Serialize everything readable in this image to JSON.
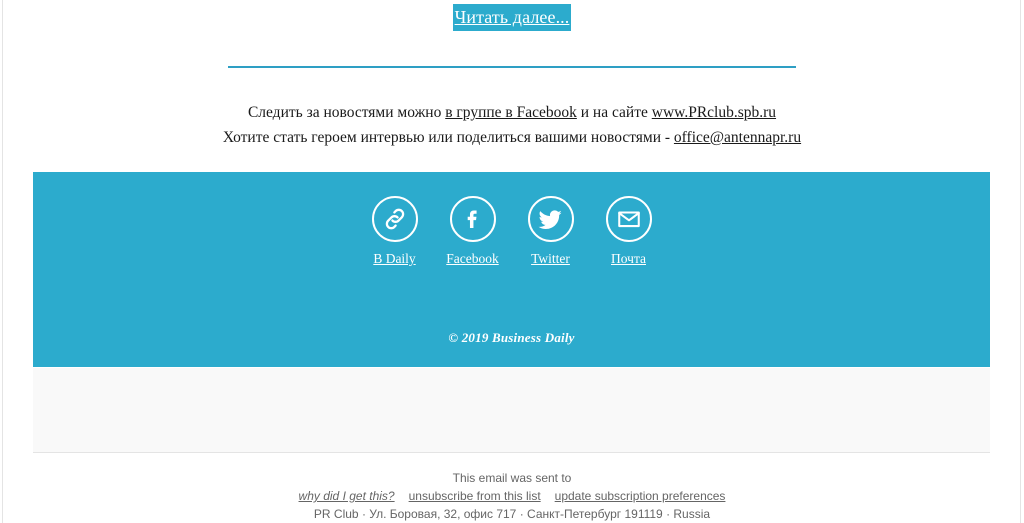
{
  "colors": {
    "brand_teal": "#2CABCD",
    "divider_teal": "#2E9FC4",
    "gray_block": "#F9F9F9",
    "footer_text": "#656565",
    "body_text": "#1A1A1A"
  },
  "read_more": {
    "label": "Читать далее..."
  },
  "intro": {
    "line1": {
      "before": "Следить за новостями можно ",
      "link1": "в группе в Facebook",
      "middle": " и на сайте ",
      "link2": "www.PRclub.spb.ru"
    },
    "line2": {
      "before": "Хотите стать героем интервью или поделиться вашими новостями - ",
      "link1": "office@antennapr.ru"
    }
  },
  "social": {
    "items": [
      {
        "icon": "link-icon",
        "label": "В Daily"
      },
      {
        "icon": "facebook-icon",
        "label": "Facebook"
      },
      {
        "icon": "twitter-icon",
        "label": "Twitter"
      },
      {
        "icon": "email-icon",
        "label": "Почта"
      }
    ],
    "copyright": "© 2019 Business Daily"
  },
  "footer": {
    "sent_to": "This email was sent to",
    "links": [
      {
        "label": "why did I get this?",
        "style": "italic"
      },
      {
        "label": "unsubscribe from this list",
        "style": "normal"
      },
      {
        "label": "update subscription preferences",
        "style": "normal"
      }
    ],
    "address": "PR Club · Ул. Боровая, 32, офис 717 · Санкт-Петербург 191119 · Russia"
  }
}
